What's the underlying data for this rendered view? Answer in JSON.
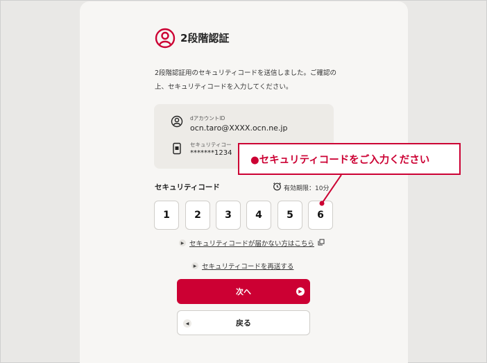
{
  "header": {
    "title": "2段階認証",
    "icon": "user-circle-icon"
  },
  "description": "2段階認証用のセキュリティコードを送信しました。ご確認の上、セキュリティコードを入力してください。",
  "info": {
    "account_label": "dアカウントID",
    "account_value": "ocn.taro@XXXX.ocn.ne.jp",
    "phone_label": "セキュリティコー",
    "phone_value": "*******1234"
  },
  "code": {
    "label": "セキュリティコード",
    "timer": "有効期限：10分",
    "digits": [
      "1",
      "2",
      "3",
      "4",
      "5",
      "6"
    ]
  },
  "links": {
    "not_received": "セキュリティコードが届かない方はこちら",
    "resend": "セキュリティコードを再送する"
  },
  "buttons": {
    "next": "次へ",
    "back": "戻る"
  },
  "callout": {
    "text": "●セキュリティコードをご入力ください"
  },
  "colors": {
    "accent": "#cc0033",
    "card_bg": "#f7f6f4",
    "page_bg": "#e9e8e6"
  }
}
